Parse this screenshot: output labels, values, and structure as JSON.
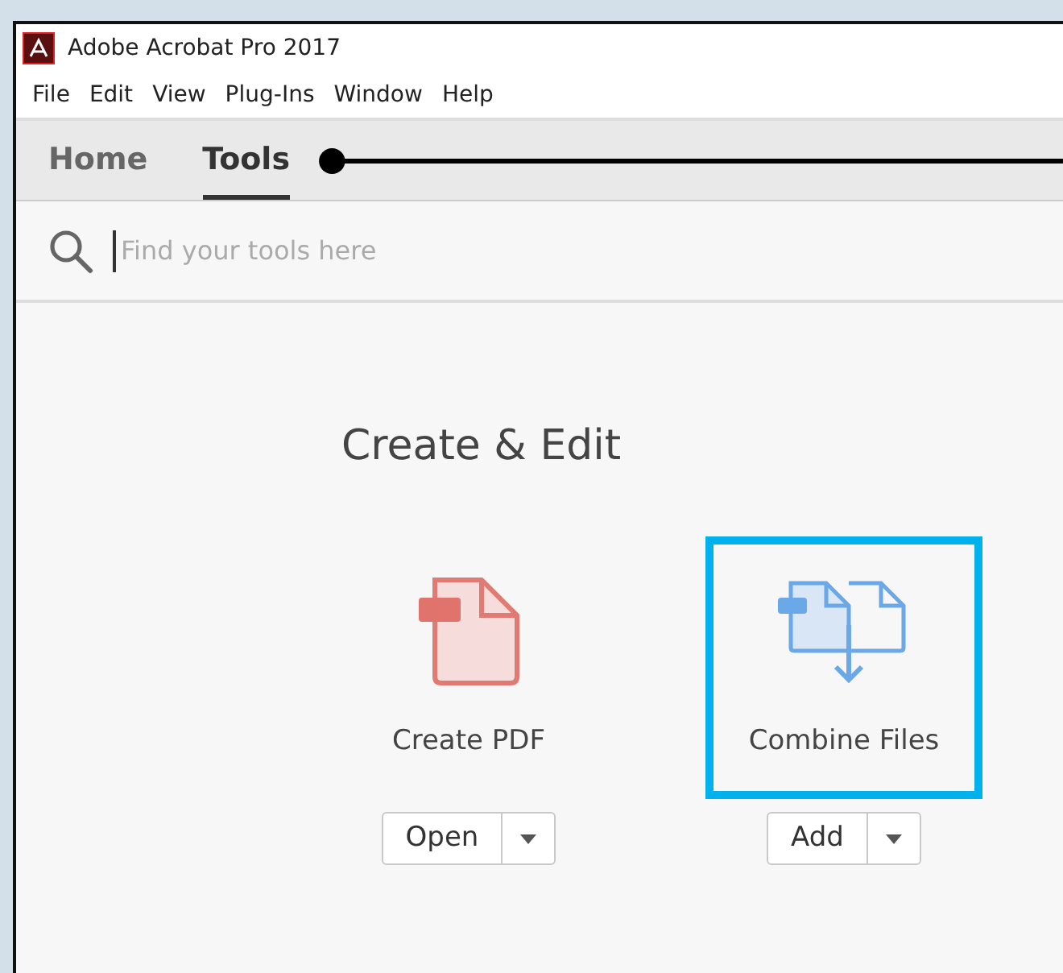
{
  "window": {
    "title": "Adobe Acrobat Pro 2017"
  },
  "menu": [
    "File",
    "Edit",
    "View",
    "Plug-Ins",
    "Window",
    "Help"
  ],
  "tabs": [
    {
      "label": "Home",
      "selected": false
    },
    {
      "label": "Tools",
      "selected": true
    }
  ],
  "search": {
    "placeholder": "Find your tools here"
  },
  "section": {
    "title": "Create & Edit",
    "tools": [
      {
        "kind": "create-pdf",
        "label": "Create PDF",
        "action": "Open",
        "highlighted": false
      },
      {
        "kind": "combine-files",
        "label": "Combine Files",
        "action": "Add",
        "highlighted": true
      }
    ]
  }
}
